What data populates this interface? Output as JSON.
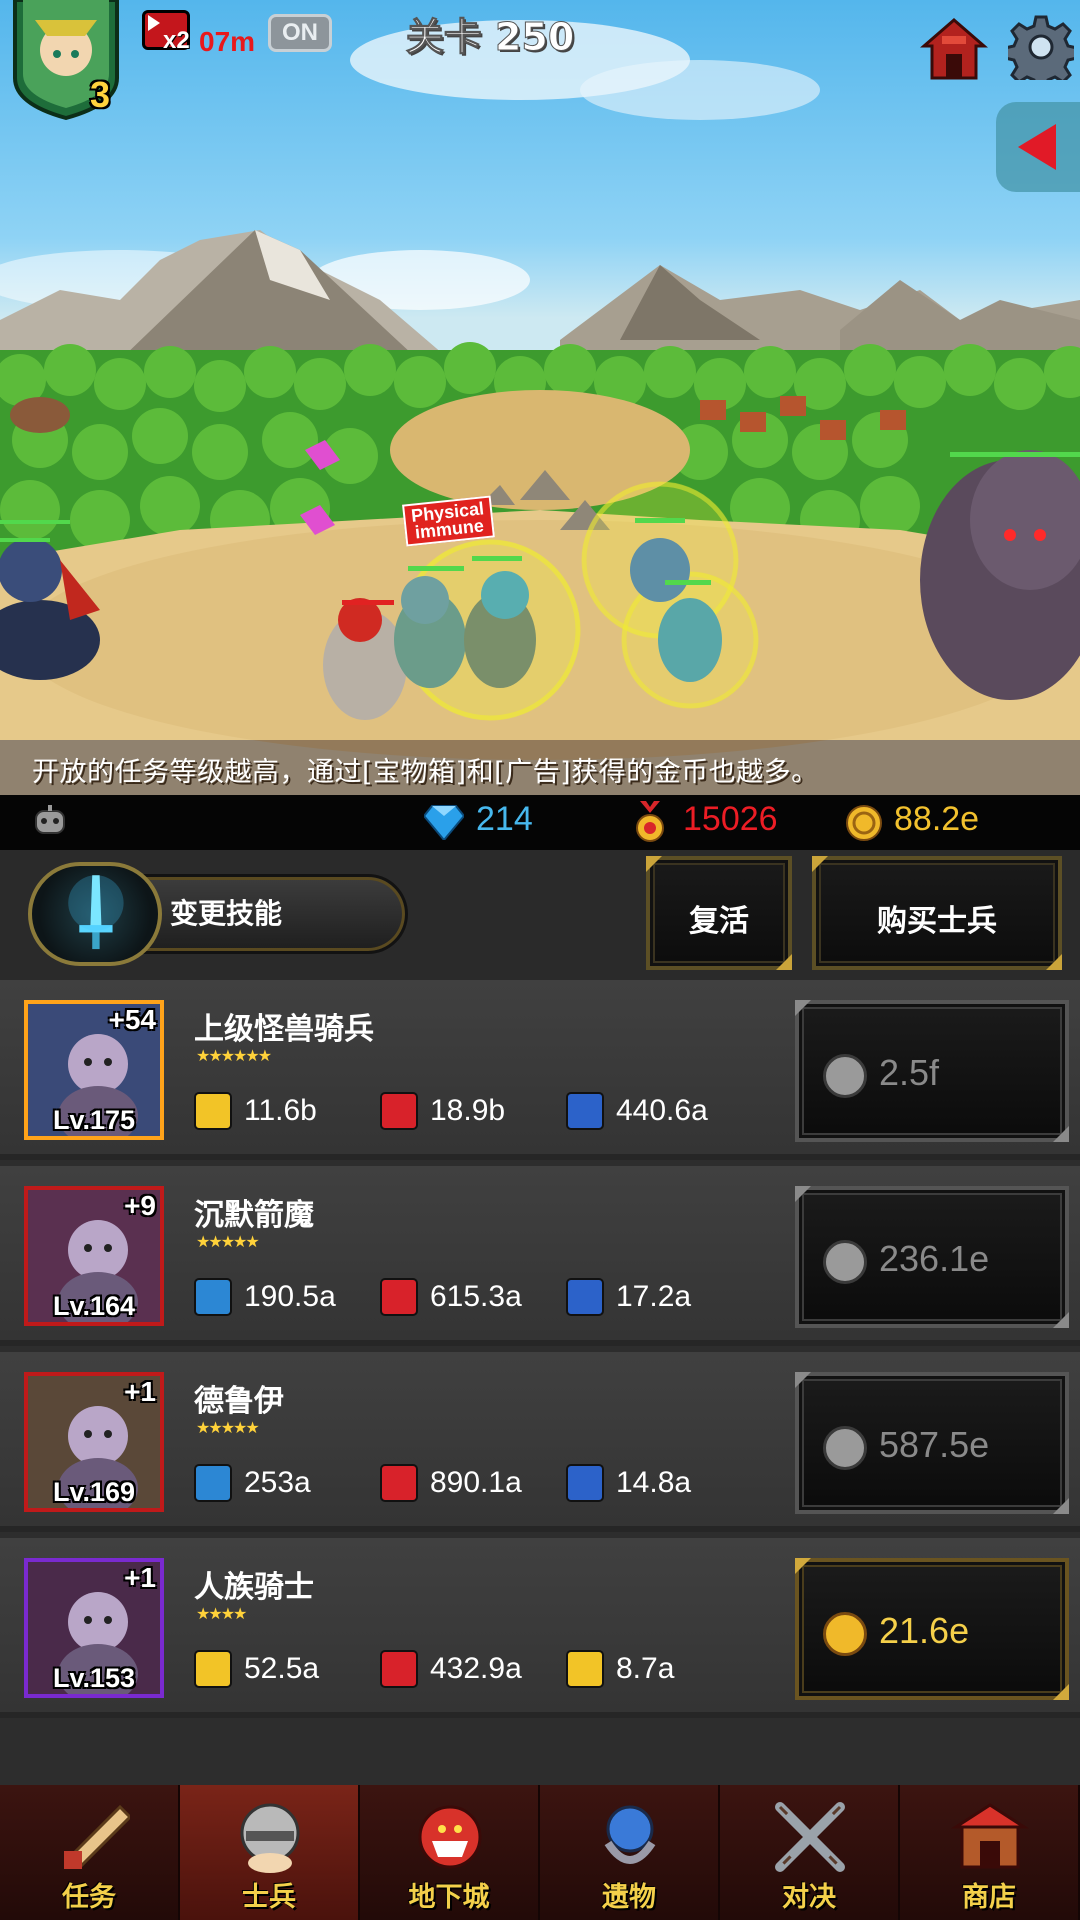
{
  "hud": {
    "player_level": "3",
    "speed_multiplier": "x2",
    "speed_timer": "07m",
    "speed_toggle": "ON",
    "stage_title": "关卡 250",
    "icons": [
      "hero-avatar-icon",
      "speed-boost-icon",
      "home-icon",
      "gear-icon",
      "side-panel-arrow-icon"
    ]
  },
  "battle": {
    "status_tag_line1": "Physical",
    "status_tag_line2": "immune",
    "tip": "开放的任务等级越高，通过[宝物箱]和[广告]获得的金币也越多。"
  },
  "resources": {
    "gems": "214",
    "medals": "15026",
    "gold": "88.2e"
  },
  "actions": {
    "change_skill": "变更技能",
    "revive": "复活",
    "buy_soldier": "购买士兵"
  },
  "soldiers": [
    {
      "name": "上级怪兽骑兵",
      "plus": "+54",
      "level": "Lv.175",
      "stars": "★★★★★★",
      "stat1": "11.6b",
      "stat1_type": "attack",
      "stat2": "18.9b",
      "stat3": "440.6a",
      "price": "2.5f",
      "affordable": false,
      "frame_color": "#ffa31a"
    },
    {
      "name": "沉默箭魔",
      "plus": "+9",
      "level": "Lv.164",
      "stars": "★★★★★",
      "stat1": "190.5a",
      "stat1_type": "magic",
      "stat2": "615.3a",
      "stat3": "17.2a",
      "price": "236.1e",
      "affordable": false,
      "frame_color": "#c01a1a"
    },
    {
      "name": "德鲁伊",
      "plus": "+1",
      "level": "Lv.169",
      "stars": "★★★★★",
      "stat1": "253a",
      "stat1_type": "magic",
      "stat2": "890.1a",
      "stat3": "14.8a",
      "price": "587.5e",
      "affordable": false,
      "frame_color": "#c01a1a"
    },
    {
      "name": "人族骑士",
      "plus": "+1",
      "level": "Lv.153",
      "stars": "★★★★",
      "stat1": "52.5a",
      "stat1_type": "attack",
      "stat2": "432.9a",
      "stat3": "8.7a",
      "price": "21.6e",
      "affordable": true,
      "frame_color": "#7a2ad0"
    }
  ],
  "nav": [
    {
      "label": "任务",
      "icon": "scroll-icon",
      "active": false
    },
    {
      "label": "士兵",
      "icon": "soldier-helmet-icon",
      "active": true
    },
    {
      "label": "地下城",
      "icon": "dungeon-monster-icon",
      "active": false
    },
    {
      "label": "遗物",
      "icon": "relic-orb-icon",
      "active": false
    },
    {
      "label": "对决",
      "icon": "crossed-swords-icon",
      "active": false
    },
    {
      "label": "商店",
      "icon": "shop-icon",
      "active": false
    }
  ],
  "colors": {
    "gem": "#47b8ee",
    "medal": "#ec1d25",
    "gold": "#f2c12e",
    "nav_label": "#f4d04a"
  }
}
